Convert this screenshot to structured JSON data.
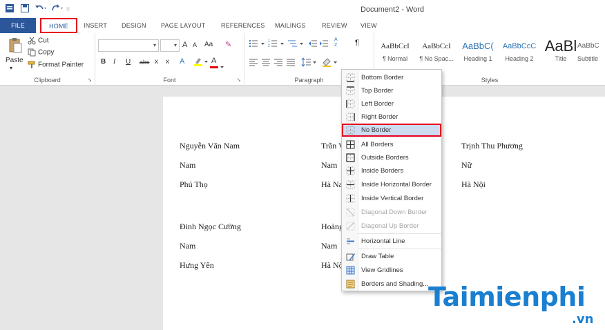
{
  "window": {
    "title": "Document2 - Word"
  },
  "quick_access": {
    "icons": [
      "word-app-icon",
      "save-icon",
      "undo-icon",
      "redo-icon",
      "customize-icon"
    ]
  },
  "tabs": [
    {
      "label": "FILE"
    },
    {
      "label": "HOME"
    },
    {
      "label": "INSERT"
    },
    {
      "label": "DESIGN"
    },
    {
      "label": "PAGE LAYOUT"
    },
    {
      "label": "REFERENCES"
    },
    {
      "label": "MAILINGS"
    },
    {
      "label": "REVIEW"
    },
    {
      "label": "VIEW"
    }
  ],
  "clipboard": {
    "paste_label": "Paste",
    "cut_label": "Cut",
    "copy_label": "Copy",
    "format_painter_label": "Format Painter",
    "group_label": "Clipboard"
  },
  "font": {
    "font_name_value": "",
    "font_size_value": "",
    "grow": "A",
    "shrink": "A",
    "change_case": "Aa",
    "bold": "B",
    "italic": "I",
    "underline": "U",
    "strike": "abc",
    "subscript": "x",
    "superscript": "x",
    "text_effects": "A",
    "font_color": "A",
    "group_label": "Font"
  },
  "paragraph": {
    "group_label": "Paragraph",
    "sort": "A Z",
    "pilcrow": "¶"
  },
  "styles": {
    "group_label": "Styles",
    "items": [
      {
        "sample": "AaBbCcI",
        "name": "¶ Normal"
      },
      {
        "sample": "AaBbCcI",
        "name": "¶ No Spac..."
      },
      {
        "sample": "AaBbC(",
        "name": "Heading 1"
      },
      {
        "sample": "AaBbCcC",
        "name": "Heading 2"
      },
      {
        "sample": "AaBl",
        "name": "Title"
      },
      {
        "sample": "AaBbC",
        "name": "Subtitle"
      }
    ]
  },
  "borders_menu": {
    "items": [
      {
        "label": "Bottom Border",
        "icon": "bottom-border-icon",
        "disabled": false
      },
      {
        "label": "Top Border",
        "icon": "top-border-icon",
        "disabled": false
      },
      {
        "label": "Left Border",
        "icon": "left-border-icon",
        "disabled": false
      },
      {
        "label": "Right Border",
        "icon": "right-border-icon",
        "disabled": false
      },
      {
        "label": "No Border",
        "icon": "no-border-icon",
        "disabled": false,
        "highlighted": true
      },
      {
        "label": "All Borders",
        "icon": "all-borders-icon",
        "disabled": false
      },
      {
        "label": "Outside Borders",
        "icon": "outside-borders-icon",
        "disabled": false
      },
      {
        "label": "Inside Borders",
        "icon": "inside-borders-icon",
        "disabled": false
      },
      {
        "label": "Inside Horizontal Border",
        "icon": "inside-horizontal-border-icon",
        "disabled": false
      },
      {
        "label": "Inside Vertical Border",
        "icon": "inside-vertical-border-icon",
        "disabled": false
      },
      {
        "label": "Diagonal Down Border",
        "icon": "diagonal-down-border-icon",
        "disabled": true
      },
      {
        "label": "Diagonal Up Border",
        "icon": "diagonal-up-border-icon",
        "disabled": true
      },
      {
        "label": "Horizontal Line",
        "icon": "horizontal-line-icon",
        "disabled": false
      },
      {
        "label": "Draw Table",
        "icon": "draw-table-icon",
        "disabled": false
      },
      {
        "label": "View Gridlines",
        "icon": "view-gridlines-icon",
        "disabled": false
      },
      {
        "label": "Borders and Shading...",
        "icon": "borders-shading-icon",
        "disabled": false
      }
    ]
  },
  "document": {
    "rows": [
      [
        "Nguyễn Văn Nam",
        "Trần V",
        "Trịnh Thu Phương"
      ],
      [
        "Nam",
        "Nam",
        "Nữ"
      ],
      [
        "Phú Thọ",
        "Hà Na",
        "Hà Nội"
      ],
      [
        "Đinh Ngọc Cường",
        "Hoàng",
        ""
      ],
      [
        "Nam",
        "Nam",
        ""
      ],
      [
        "Hưng Yên",
        "Hà Nộ",
        ""
      ]
    ]
  },
  "watermark": {
    "main": "Taimienphi",
    "suffix": ".vn"
  },
  "colors": {
    "accent": "#2b579a",
    "highlight_box": "#e8001e",
    "watermark": "#1a7fd1"
  }
}
